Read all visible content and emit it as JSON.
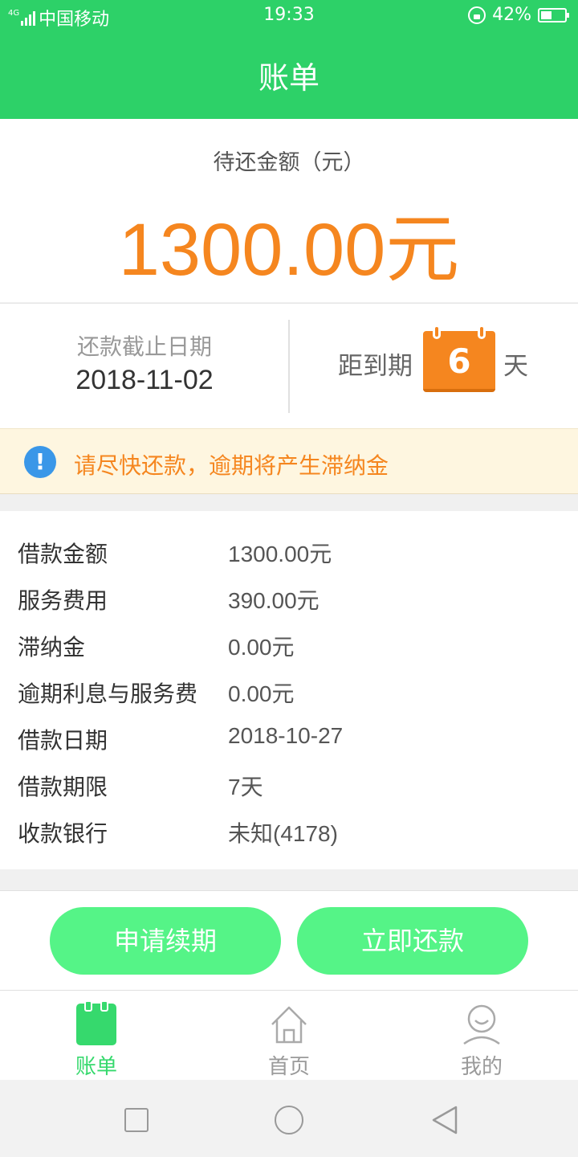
{
  "status_bar": {
    "network": "4G",
    "carrier": "中国移动",
    "time": "19:33",
    "battery": "42%"
  },
  "header": {
    "title": "账单"
  },
  "amount": {
    "label": "待还金额（元）",
    "value": "1300.00元"
  },
  "due": {
    "label": "还款截止日期",
    "date": "2018-11-02",
    "remain_label": "距到期",
    "remain_days": "6",
    "remain_unit": "天"
  },
  "notice": {
    "text": "请尽快还款，逾期将产生滞纳金"
  },
  "details": [
    {
      "key": "借款金额",
      "value": "1300.00元"
    },
    {
      "key": "服务费用",
      "value": "390.00元"
    },
    {
      "key": "滞纳金",
      "value": "0.00元"
    },
    {
      "key": "逾期利息与服务费",
      "value": "0.00元"
    },
    {
      "key": "借款日期",
      "value": "2018-10-27"
    },
    {
      "key": "借款期限",
      "value": "7天"
    },
    {
      "key": "收款银行",
      "value": "未知(4178)"
    }
  ],
  "actions": {
    "renew": "申请续期",
    "pay": "立即还款"
  },
  "tabs": [
    {
      "label": "账单",
      "icon": "bill-icon",
      "active": true
    },
    {
      "label": "首页",
      "icon": "home-icon",
      "active": false
    },
    {
      "label": "我的",
      "icon": "profile-icon",
      "active": false
    }
  ],
  "colors": {
    "primary_green": "#2dd168",
    "accent_orange": "#f5861f",
    "button_green": "#55f487",
    "info_blue": "#3a97e8"
  }
}
